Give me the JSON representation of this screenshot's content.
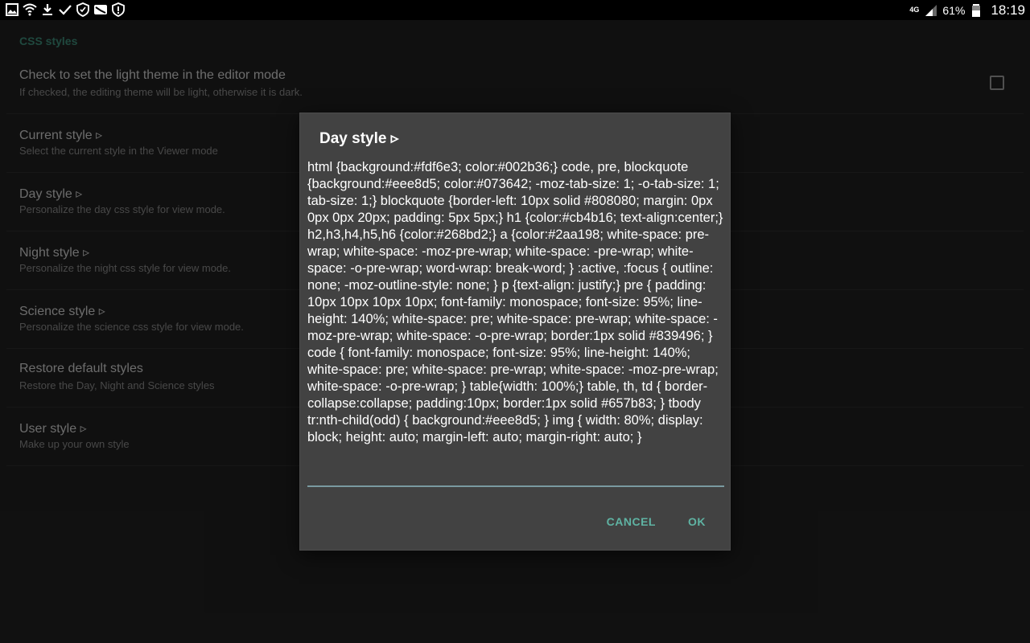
{
  "status_bar": {
    "network": "4G",
    "battery": "61%",
    "time": "18:19"
  },
  "settings": {
    "category": "CSS styles",
    "items": [
      {
        "title": "Check to set the light theme in the editor mode",
        "summary": "If checked, the editing theme will be light, otherwise it is dark.",
        "checkbox": true,
        "checked": false
      },
      {
        "title": "Current style ▹",
        "summary": "Select the current style in the Viewer mode"
      },
      {
        "title": "Day style ▹",
        "summary": "Personalize the day css style for view mode."
      },
      {
        "title": "Night style ▹",
        "summary": "Personalize the night css style for view mode."
      },
      {
        "title": "Science style ▹",
        "summary": "Personalize the science css style for view mode."
      },
      {
        "title": "Restore default styles",
        "summary": "Restore the Day, Night and Science styles"
      },
      {
        "title": "User style ▹",
        "summary": "Make up your own style"
      }
    ]
  },
  "dialog": {
    "title": "Day style ▹",
    "text": "html {background:#fdf6e3; color:#002b36;} code, pre, blockquote {background:#eee8d5; color:#073642; -moz-tab-size: 1; -o-tab-size: 1; tab-size: 1;} blockquote {border-left: 10px solid #808080; margin: 0px 0px 0px 20px; padding: 5px 5px;} h1 {color:#cb4b16; text-align:center;} h2,h3,h4,h5,h6 {color:#268bd2;} a {color:#2aa198; white-space: pre-wrap; white-space: -moz-pre-wrap; white-space: -pre-wrap; white-space: -o-pre-wrap; word-wrap: break-word; } :active, :focus { outline: none; -moz-outline-style: none; } p {text-align: justify;} pre { padding: 10px 10px 10px 10px; font-family: monospace; font-size: 95%; line-height: 140%; white-space: pre; white-space: pre-wrap; white-space: -moz-pre-wrap; white-space: -o-pre-wrap; border:1px solid #839496; } code { font-family: monospace; font-size: 95%; line-height: 140%; white-space: pre; white-space: pre-wrap; white-space: -moz-pre-wrap; white-space: -o-pre-wrap; } table{width: 100%;} table, th, td { border-collapse:collapse; padding:10px; border:1px solid #657b83; } tbody tr:nth-child(odd) { background:#eee8d5; } img { width: 80%; display: block; height: auto; margin-left: auto; margin-right: auto; }",
    "cancel_label": "CANCEL",
    "ok_label": "OK"
  },
  "colors": {
    "accent": "#5fb3a3",
    "category": "#3d8a78",
    "dialog_bg": "#424242"
  }
}
